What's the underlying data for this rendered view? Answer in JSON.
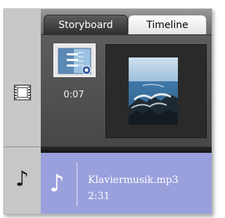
{
  "tabs": [
    {
      "label": "Storyboard",
      "active": true
    },
    {
      "label": "Timeline",
      "active": false
    }
  ],
  "video_track": {
    "icon": "film-strip-icon",
    "transition_thumbnail": {
      "icon": "transition-effect-icon",
      "duration": "0:07"
    },
    "clip_preview": {
      "description_icon": "ocean-photo-thumbnail"
    }
  },
  "audio_track": {
    "icon": "music-note-icon",
    "clip": {
      "icon": "music-note-icon",
      "name": "Klaviermusik.mp3",
      "duration": "2:31"
    }
  },
  "colors": {
    "active_tab": "#3a3a3a",
    "inactive_tab": "#ffffff",
    "video_track_bg": "#525252",
    "audio_track_bg": "#9aa0dc"
  }
}
